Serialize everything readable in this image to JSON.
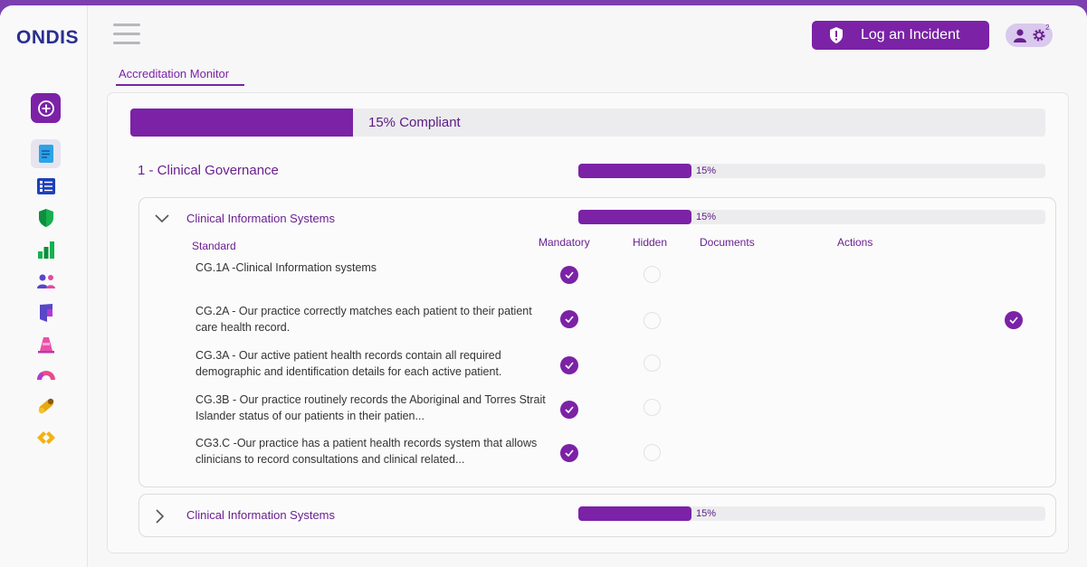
{
  "app": {
    "logo": "ONDIS"
  },
  "header": {
    "incident_label": "Log an Incident",
    "notification_count": "2"
  },
  "tab": {
    "label": "Accreditation Monitor"
  },
  "overall": {
    "percent_value": 15,
    "label": "15% Compliant"
  },
  "category": {
    "title": "1 - Clinical Governance",
    "percent_value": 15,
    "percent_label": "15%"
  },
  "sections": [
    {
      "title": "Clinical Information Systems",
      "expanded": true,
      "percent_value": 15,
      "percent_label": "15%",
      "columns": {
        "standard": "Standard",
        "mandatory": "Mandatory",
        "hidden": "Hidden",
        "documents": "Documents",
        "actions": "Actions"
      },
      "rows": [
        {
          "text": "CG.1A -Clinical Information systems",
          "mandatory": true,
          "hidden": false,
          "action_done": false
        },
        {
          "text": "CG.2A - Our practice correctly matches each patient to their patient care health record.",
          "mandatory": true,
          "hidden": false,
          "action_done": true
        },
        {
          "text": "CG.3A - Our active patient health records contain all required demographic and identification details for each active patient.",
          "mandatory": true,
          "hidden": false,
          "action_done": false
        },
        {
          "text": "CG.3B - Our practice routinely records the Aboriginal and Torres Strait Islander status of our patients in their patien...",
          "mandatory": true,
          "hidden": false,
          "action_done": false
        },
        {
          "text": "CG3.C -Our practice has a patient health records system that allows clinicians to record consultations and clinical related...",
          "mandatory": true,
          "hidden": false,
          "action_done": false
        }
      ]
    },
    {
      "title": "Clinical Information Systems",
      "expanded": false,
      "percent_value": 15,
      "percent_label": "15%"
    }
  ],
  "colors": {
    "accent": "#7b22a6",
    "track": "#ececee",
    "text_purple": "#6a2090"
  },
  "icons": [
    "plus-circle-icon",
    "document-icon",
    "checklist-icon",
    "shield-icon",
    "bar-chart-icon",
    "people-icon",
    "door-icon",
    "cone-icon",
    "gauge-icon",
    "pill-icon",
    "diamond-arrows-icon"
  ]
}
